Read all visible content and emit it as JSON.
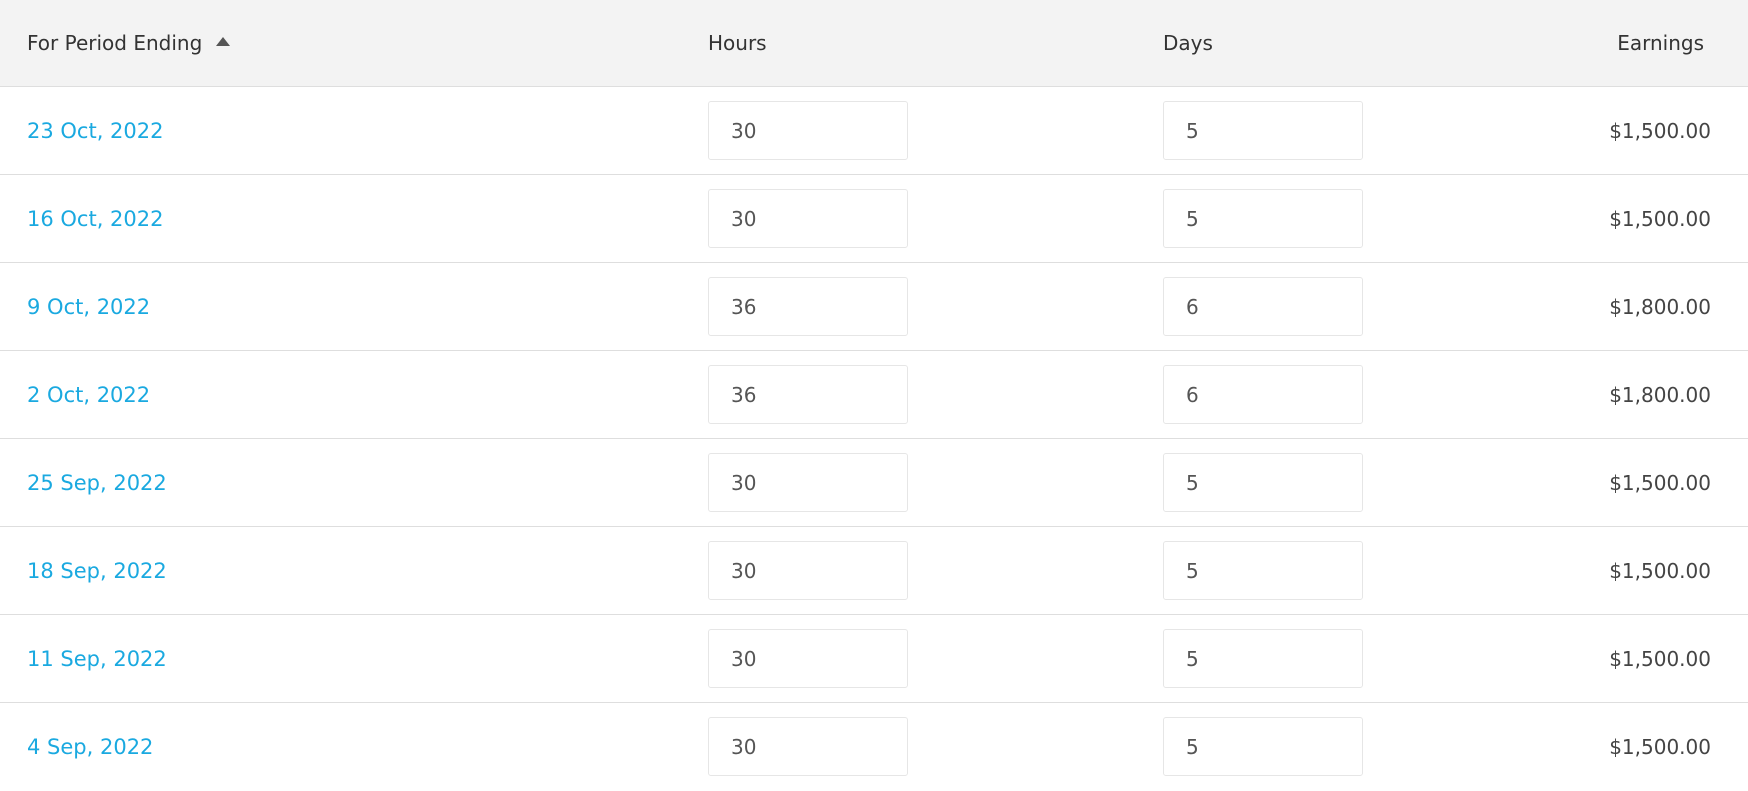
{
  "colors": {
    "link": "#1aa9e0",
    "header_bg": "#f3f3f3",
    "border": "#dedede",
    "text": "#333333"
  },
  "table": {
    "columns": {
      "period": "For Period Ending",
      "hours": "Hours",
      "days": "Days",
      "earnings": "Earnings"
    },
    "sort": {
      "column": "period",
      "direction": "ascending",
      "icon": "sort-ascending-icon"
    },
    "rows": [
      {
        "period": "23 Oct, 2022",
        "hours": "30",
        "days": "5",
        "earnings": "$1,500.00"
      },
      {
        "period": "16 Oct, 2022",
        "hours": "30",
        "days": "5",
        "earnings": "$1,500.00"
      },
      {
        "period": "9 Oct, 2022",
        "hours": "36",
        "days": "6",
        "earnings": "$1,800.00"
      },
      {
        "period": "2 Oct, 2022",
        "hours": "36",
        "days": "6",
        "earnings": "$1,800.00"
      },
      {
        "period": "25 Sep, 2022",
        "hours": "30",
        "days": "5",
        "earnings": "$1,500.00"
      },
      {
        "period": "18 Sep, 2022",
        "hours": "30",
        "days": "5",
        "earnings": "$1,500.00"
      },
      {
        "period": "11 Sep, 2022",
        "hours": "30",
        "days": "5",
        "earnings": "$1,500.00"
      },
      {
        "period": "4 Sep, 2022",
        "hours": "30",
        "days": "5",
        "earnings": "$1,500.00"
      }
    ]
  }
}
